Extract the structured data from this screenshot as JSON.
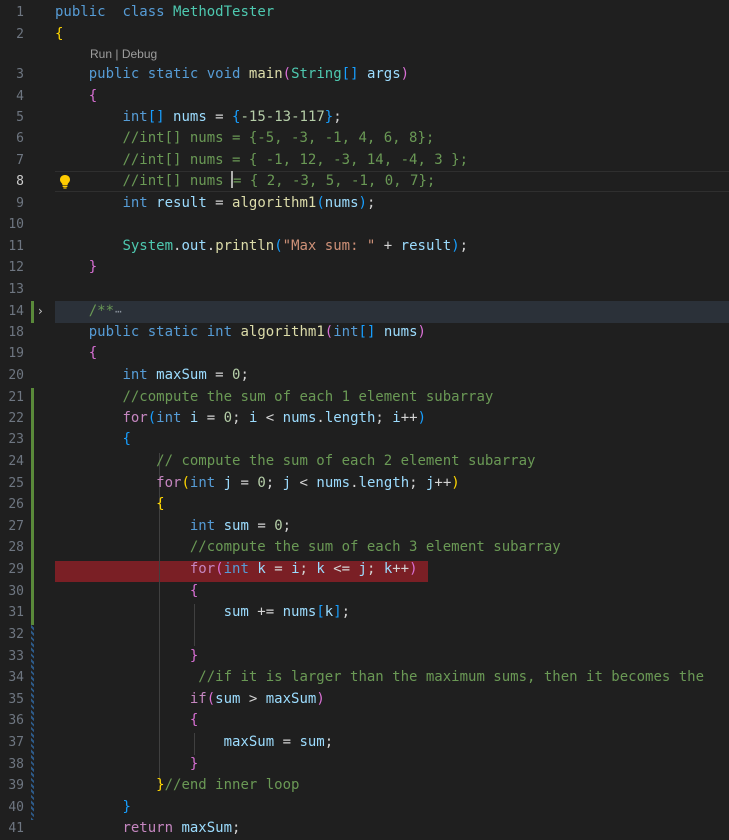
{
  "editor": {
    "codelens": {
      "run": "Run",
      "sep": " | ",
      "debug": "Debug"
    },
    "fold_ellipsis": "⋯",
    "lines": [
      {
        "n": "1"
      },
      {
        "n": "2"
      },
      {
        "n": "3"
      },
      {
        "n": "4"
      },
      {
        "n": "5"
      },
      {
        "n": "6"
      },
      {
        "n": "7"
      },
      {
        "n": "8"
      },
      {
        "n": "9"
      },
      {
        "n": "10"
      },
      {
        "n": "11"
      },
      {
        "n": "12"
      },
      {
        "n": "13"
      },
      {
        "n": "14"
      },
      {
        "n": "18"
      },
      {
        "n": "19"
      },
      {
        "n": "20"
      },
      {
        "n": "21"
      },
      {
        "n": "22"
      },
      {
        "n": "23"
      },
      {
        "n": "24"
      },
      {
        "n": "25"
      },
      {
        "n": "26"
      },
      {
        "n": "27"
      },
      {
        "n": "28"
      },
      {
        "n": "29"
      },
      {
        "n": "30"
      },
      {
        "n": "31"
      },
      {
        "n": "32"
      },
      {
        "n": "33"
      },
      {
        "n": "34"
      },
      {
        "n": "35"
      },
      {
        "n": "36"
      },
      {
        "n": "37"
      },
      {
        "n": "38"
      },
      {
        "n": "39"
      },
      {
        "n": "40"
      },
      {
        "n": "41"
      }
    ],
    "code": [
      [
        [
          "kw",
          "public"
        ],
        [
          "",
          "  "
        ],
        [
          "kw",
          "class"
        ],
        [
          "",
          " "
        ],
        [
          "ty",
          "MethodTester"
        ]
      ],
      [
        [
          "by",
          "{"
        ]
      ],
      [
        [
          "",
          "    "
        ],
        [
          "kw",
          "public"
        ],
        [
          "",
          " "
        ],
        [
          "kw",
          "static"
        ],
        [
          "",
          " "
        ],
        [
          "kw",
          "void"
        ],
        [
          "",
          " "
        ],
        [
          "fn",
          "main"
        ],
        [
          "bp",
          "("
        ],
        [
          "ty",
          "String"
        ],
        [
          "bb",
          "[]"
        ],
        [
          "",
          " "
        ],
        [
          "var",
          "args"
        ],
        [
          "bp",
          ")"
        ]
      ],
      [
        [
          "",
          "    "
        ],
        [
          "bp",
          "{"
        ]
      ],
      [
        [
          "",
          "        "
        ],
        [
          "kw",
          "int"
        ],
        [
          "bb",
          "[]"
        ],
        [
          "",
          " "
        ],
        [
          "var",
          "nums"
        ],
        [
          "",
          " = "
        ],
        [
          "bb",
          "{"
        ],
        [
          "num",
          "-1"
        ],
        [
          ", "
        ],
        [
          "num",
          "5"
        ],
        [
          ", "
        ],
        [
          "num",
          "-1"
        ],
        [
          ", "
        ],
        [
          "num",
          "3"
        ],
        [
          ", "
        ],
        [
          "num",
          "-1"
        ],
        [
          ", "
        ],
        [
          "num",
          "17"
        ],
        [
          "bb",
          "}"
        ],
        [
          "",
          ";"
        ]
      ],
      [
        [
          "",
          "        "
        ],
        [
          "cm",
          "//int[] nums = {-5, -3, -1, 4, 6, 8};"
        ]
      ],
      [
        [
          "",
          "        "
        ],
        [
          "cm",
          "//int[] nums = { -1, 12, -3, 14, -4, 3 };"
        ]
      ],
      [
        [
          "",
          "        "
        ],
        [
          "cm",
          "//int[] nums "
        ],
        [
          "caret",
          ""
        ],
        [
          "cm",
          "= { 2, -3, 5, -1, 0, 7};"
        ]
      ],
      [
        [
          "",
          "        "
        ],
        [
          "kw",
          "int"
        ],
        [
          "",
          " "
        ],
        [
          "var",
          "result"
        ],
        [
          "",
          " = "
        ],
        [
          "fn",
          "algorithm1"
        ],
        [
          "bb",
          "("
        ],
        [
          "var",
          "nums"
        ],
        [
          "bb",
          ")"
        ],
        [
          "",
          ";"
        ]
      ],
      [],
      [
        [
          "",
          "        "
        ],
        [
          "ty",
          "System"
        ],
        [
          "",
          "."
        ],
        [
          "var",
          "out"
        ],
        [
          "",
          "."
        ],
        [
          "fn",
          "println"
        ],
        [
          "bb",
          "("
        ],
        [
          "str",
          "\"Max sum: \""
        ],
        [
          "",
          " + "
        ],
        [
          "var",
          "result"
        ],
        [
          "bb",
          ")"
        ],
        [
          "",
          ";"
        ]
      ],
      [
        [
          "",
          "    "
        ],
        [
          "bp",
          "}"
        ]
      ],
      [],
      [
        [
          "",
          "    "
        ],
        [
          "cm",
          "/**"
        ],
        [
          "fold",
          "⋯"
        ]
      ],
      [
        [
          "",
          "    "
        ],
        [
          "kw",
          "public"
        ],
        [
          "",
          " "
        ],
        [
          "kw",
          "static"
        ],
        [
          "",
          " "
        ],
        [
          "kw",
          "int"
        ],
        [
          "",
          " "
        ],
        [
          "fn",
          "algorithm1"
        ],
        [
          "bp",
          "("
        ],
        [
          "kw",
          "int"
        ],
        [
          "bb",
          "[]"
        ],
        [
          "",
          " "
        ],
        [
          "var",
          "nums"
        ],
        [
          "bp",
          ")"
        ]
      ],
      [
        [
          "",
          "    "
        ],
        [
          "bp",
          "{"
        ]
      ],
      [
        [
          "",
          "        "
        ],
        [
          "kw",
          "int"
        ],
        [
          "",
          " "
        ],
        [
          "var",
          "maxSum"
        ],
        [
          "",
          " = "
        ],
        [
          "num",
          "0"
        ],
        [
          "",
          ";"
        ]
      ],
      [
        [
          "",
          "        "
        ],
        [
          "cm",
          "//compute the sum of each 1 element subarray"
        ]
      ],
      [
        [
          "",
          "        "
        ],
        [
          "ctl",
          "for"
        ],
        [
          "bb",
          "("
        ],
        [
          "kw",
          "int"
        ],
        [
          "",
          " "
        ],
        [
          "var",
          "i"
        ],
        [
          "",
          " = "
        ],
        [
          "num",
          "0"
        ],
        [
          "",
          "; "
        ],
        [
          "var",
          "i"
        ],
        [
          "",
          " < "
        ],
        [
          "var",
          "nums"
        ],
        [
          "",
          "."
        ],
        [
          "var",
          "length"
        ],
        [
          "",
          "; "
        ],
        [
          "var",
          "i"
        ],
        [
          "",
          "++"
        ],
        [
          "bb",
          ")"
        ]
      ],
      [
        [
          "",
          "        "
        ],
        [
          "bb",
          "{"
        ]
      ],
      [
        [
          "",
          "            "
        ],
        [
          "cm",
          "// compute the sum of each 2 element subarray"
        ]
      ],
      [
        [
          "",
          "            "
        ],
        [
          "ctl",
          "for"
        ],
        [
          "by",
          "("
        ],
        [
          "kw",
          "int"
        ],
        [
          "",
          " "
        ],
        [
          "var",
          "j"
        ],
        [
          "",
          " = "
        ],
        [
          "num",
          "0"
        ],
        [
          "",
          "; "
        ],
        [
          "var",
          "j"
        ],
        [
          "",
          " < "
        ],
        [
          "var",
          "nums"
        ],
        [
          "",
          "."
        ],
        [
          "var",
          "length"
        ],
        [
          "",
          "; "
        ],
        [
          "var",
          "j"
        ],
        [
          "",
          "++"
        ],
        [
          "by",
          ")"
        ]
      ],
      [
        [
          "",
          "            "
        ],
        [
          "by",
          "{"
        ]
      ],
      [
        [
          "",
          "                "
        ],
        [
          "kw",
          "int"
        ],
        [
          "",
          " "
        ],
        [
          "var",
          "sum"
        ],
        [
          "",
          " = "
        ],
        [
          "num",
          "0"
        ],
        [
          "",
          ";"
        ]
      ],
      [
        [
          "",
          "                "
        ],
        [
          "cm",
          "//compute the sum of each 3 element subarray"
        ]
      ],
      [
        [
          "",
          "                "
        ],
        [
          "ctl",
          "for"
        ],
        [
          "bp",
          "("
        ],
        [
          "kw",
          "int"
        ],
        [
          "",
          " "
        ],
        [
          "var",
          "k"
        ],
        [
          "",
          " = "
        ],
        [
          "var",
          "i"
        ],
        [
          "",
          "; "
        ],
        [
          "var",
          "k"
        ],
        [
          "",
          " <= "
        ],
        [
          "var",
          "j"
        ],
        [
          "",
          "; "
        ],
        [
          "var",
          "k"
        ],
        [
          "",
          "++"
        ],
        [
          "bp",
          ")"
        ]
      ],
      [
        [
          "",
          "                "
        ],
        [
          "bp",
          "{"
        ]
      ],
      [
        [
          "",
          "                    "
        ],
        [
          "var",
          "sum"
        ],
        [
          "",
          " += "
        ],
        [
          "var",
          "nums"
        ],
        [
          "bb",
          "["
        ],
        [
          "var",
          "k"
        ],
        [
          "bb",
          "]"
        ],
        [
          "",
          ";"
        ]
      ],
      [],
      [
        [
          "",
          "                "
        ],
        [
          "bp",
          "}"
        ]
      ],
      [
        [
          "",
          "                 "
        ],
        [
          "cm",
          "//if it is larger than the maximum sums, then it becomes the"
        ]
      ],
      [
        [
          "",
          "                "
        ],
        [
          "ctl",
          "if"
        ],
        [
          "bp",
          "("
        ],
        [
          "var",
          "sum"
        ],
        [
          "",
          " > "
        ],
        [
          "var",
          "maxSum"
        ],
        [
          "bp",
          ")"
        ]
      ],
      [
        [
          "",
          "                "
        ],
        [
          "bp",
          "{"
        ]
      ],
      [
        [
          "",
          "                    "
        ],
        [
          "var",
          "maxSum"
        ],
        [
          "",
          " = "
        ],
        [
          "var",
          "sum"
        ],
        [
          "",
          ";"
        ]
      ],
      [
        [
          "",
          "                "
        ],
        [
          "bp",
          "}"
        ]
      ],
      [
        [
          "",
          "            "
        ],
        [
          "by",
          "}"
        ],
        [
          "cm",
          "//end inner loop"
        ]
      ],
      [
        [
          "",
          "        "
        ],
        [
          "bb",
          "}"
        ]
      ],
      [
        [
          "",
          "        "
        ],
        [
          "ctl",
          "return"
        ],
        [
          "",
          " "
        ],
        [
          "var",
          "maxSum"
        ],
        [
          "",
          ";"
        ]
      ]
    ]
  }
}
